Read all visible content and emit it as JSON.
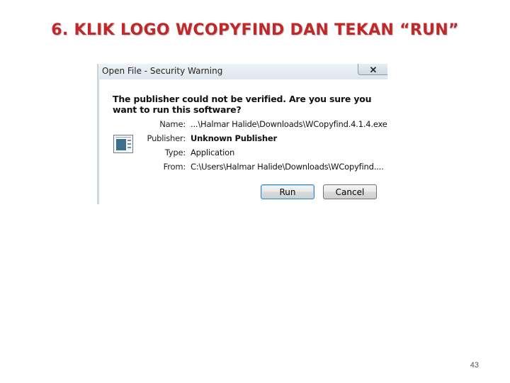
{
  "slide": {
    "title": "6. KLIK LOGO WCOPYFIND DAN TEKAN  “RUN”",
    "page_number": "43",
    "title_color": "#c0282a"
  },
  "dialog": {
    "title": "Open File - Security Warning",
    "close_glyph": "✕",
    "question": "The publisher could not be verified.  Are you sure you want to run this software?",
    "icon": "executable-file-icon",
    "fields": [
      {
        "label": "Name:",
        "value": "...\\Halmar Halide\\Downloads\\WCopyfind.4.1.4.exe"
      },
      {
        "label": "Publisher:",
        "value": "Unknown Publisher"
      },
      {
        "label": "Type:",
        "value": "Application"
      },
      {
        "label": "From:",
        "value": "C:\\Users\\Halmar Halide\\Downloads\\WCopyfind...."
      }
    ],
    "buttons": {
      "run": "Run",
      "cancel": "Cancel"
    }
  }
}
